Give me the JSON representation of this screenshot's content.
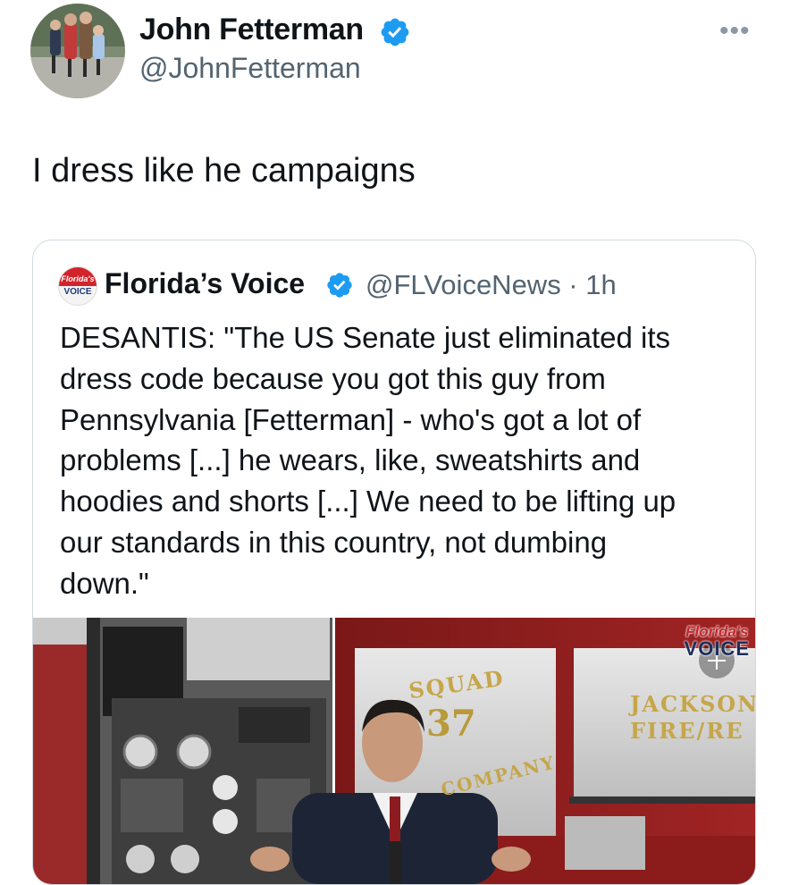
{
  "author": {
    "name": "John Fetterman",
    "handle": "@JohnFetterman",
    "avatar_icon": "family-photo-avatar",
    "verified_icon": "verified-badge-icon"
  },
  "more_icon": "•••",
  "tweet": {
    "text": "I dress like he campaigns"
  },
  "quote": {
    "avatar_line1": "Florida's",
    "avatar_line2": "VOICE",
    "name": "Florida’s Voice",
    "handle_time": "@FLVoiceNews · 1h",
    "body": "DESANTIS: \"The US Senate just eliminated its\ndress code because you got this guy from\nPennsylvania [Fetterman] - who's got a lot of\nproblems [...] he wears, like, sweatshirts and\nhoodies and shorts [...] We need to be lifting up\nour standards in this country, not dumbing\ndown.\"",
    "media": {
      "watermark_line1": "Florida's",
      "watermark_line2": "VOICE",
      "squad": "SQUAD",
      "number": "37",
      "company": "COMPANY",
      "dept_line1": "JACKSON",
      "dept_line2": "FIRE/RE"
    }
  },
  "colors": {
    "verified": "#1d9bf0",
    "secondary_text": "#536471",
    "border": "#cfd9de"
  }
}
